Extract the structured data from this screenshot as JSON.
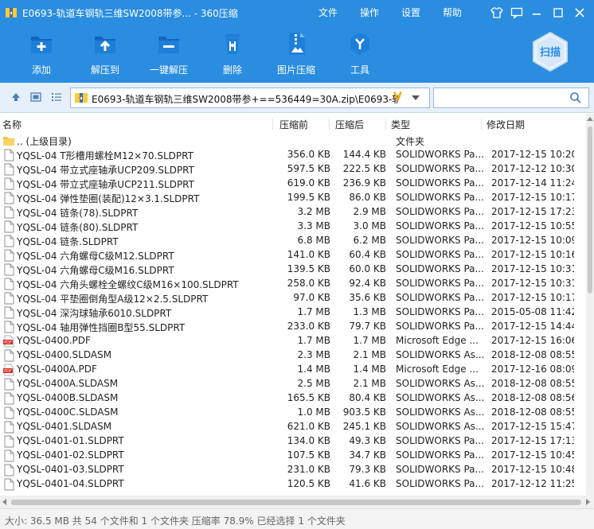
{
  "window": {
    "title": "E0693-轨道车钢轨三维SW2008带参... - 360压缩",
    "menus": [
      "文件",
      "操作",
      "设置",
      "帮助"
    ]
  },
  "toolbar": {
    "items": [
      "添加",
      "解压到",
      "一键解压",
      "删除",
      "图片压缩",
      "工具"
    ],
    "scan_label": "扫描"
  },
  "address": {
    "path": "E0693-轨道车钢轨三维SW2008带参+==536449=30A.zip\\E0693-轨道"
  },
  "search": {
    "placeholder": ""
  },
  "columns": {
    "name": "名称",
    "size": "压缩前",
    "packed": "压缩后",
    "type": "类型",
    "date": "修改日期"
  },
  "files": [
    {
      "icon": "folder",
      "name": ".. (上级目录)",
      "size": "",
      "packed": "",
      "type": "文件夹",
      "date": ""
    },
    {
      "icon": "file",
      "name": "YQSL-04 T形槽用螺栓M12×70.SLDPRT",
      "size": "356.0 KB",
      "packed": "144.4 KB",
      "type": "SOLIDWORKS Pa...",
      "date": "2017-12-15 10:20"
    },
    {
      "icon": "file",
      "name": "YQSL-04 带立式座轴承UCP209.SLDPRT",
      "size": "597.5 KB",
      "packed": "222.5 KB",
      "type": "SOLIDWORKS Pa...",
      "date": "2017-12-12 10:30"
    },
    {
      "icon": "file",
      "name": "YQSL-04 带立式座轴承UCP211.SLDPRT",
      "size": "619.0 KB",
      "packed": "236.9 KB",
      "type": "SOLIDWORKS Pa...",
      "date": "2017-12-14 11:24"
    },
    {
      "icon": "file",
      "name": "YQSL-04 弹性垫圈(装配)12×3.1.SLDPRT",
      "size": "199.5 KB",
      "packed": "86.0 KB",
      "type": "SOLIDWORKS Pa...",
      "date": "2017-12-15 10:17"
    },
    {
      "icon": "file",
      "name": "YQSL-04 链条(78).SLDPRT",
      "size": "3.2 MB",
      "packed": "2.9 MB",
      "type": "SOLIDWORKS Pa...",
      "date": "2017-12-15 17:23"
    },
    {
      "icon": "file",
      "name": "YQSL-04 链条(80).SLDPRT",
      "size": "3.3 MB",
      "packed": "3.0 MB",
      "type": "SOLIDWORKS Pa...",
      "date": "2017-12-15 10:55"
    },
    {
      "icon": "file",
      "name": "YQSL-04 链条.SLDPRT",
      "size": "6.8 MB",
      "packed": "6.2 MB",
      "type": "SOLIDWORKS Pa...",
      "date": "2017-12-15 10:09"
    },
    {
      "icon": "file",
      "name": "YQSL-04 六角螺母C级M12.SLDPRT",
      "size": "141.0 KB",
      "packed": "60.4 KB",
      "type": "SOLIDWORKS Pa...",
      "date": "2017-12-15 10:16"
    },
    {
      "icon": "file",
      "name": "YQSL-04 六角螺母C级M16.SLDPRT",
      "size": "139.5 KB",
      "packed": "60.0 KB",
      "type": "SOLIDWORKS Pa...",
      "date": "2017-12-15 10:31"
    },
    {
      "icon": "file",
      "name": "YQSL-04 六角头螺栓全螺纹C级M16×100.SLDPRT",
      "size": "258.0 KB",
      "packed": "92.4 KB",
      "type": "SOLIDWORKS Pa...",
      "date": "2017-12-15 10:31"
    },
    {
      "icon": "file",
      "name": "YQSL-04 平垫圈倒角型A级12×2.5.SLDPRT",
      "size": "97.0 KB",
      "packed": "35.6 KB",
      "type": "SOLIDWORKS Pa...",
      "date": "2017-12-15 10:17"
    },
    {
      "icon": "file",
      "name": "YQSL-04 深沟球轴承6010.SLDPRT",
      "size": "1.7 MB",
      "packed": "1.3 MB",
      "type": "SOLIDWORKS Pa...",
      "date": "2015-05-08 11:42"
    },
    {
      "icon": "file",
      "name": "YQSL-04 轴用弹性挡圈B型55.SLDPRT",
      "size": "233.0 KB",
      "packed": "79.7 KB",
      "type": "SOLIDWORKS Pa...",
      "date": "2017-12-15 14:44"
    },
    {
      "icon": "pdf",
      "name": "YQSL-0400.PDF",
      "size": "1.7 MB",
      "packed": "1.7 MB",
      "type": "Microsoft Edge ...",
      "date": "2017-12-15 16:06"
    },
    {
      "icon": "file",
      "name": "YQSL-0400.SLDASM",
      "size": "2.3 MB",
      "packed": "2.1 MB",
      "type": "SOLIDWORKS As...",
      "date": "2018-12-08 08:55"
    },
    {
      "icon": "pdf",
      "name": "YQSL-0400A.PDF",
      "size": "1.4 MB",
      "packed": "1.4 MB",
      "type": "Microsoft Edge ...",
      "date": "2017-12-16 08:09"
    },
    {
      "icon": "file",
      "name": "YQSL-0400A.SLDASM",
      "size": "2.5 MB",
      "packed": "2.1 MB",
      "type": "SOLIDWORKS As...",
      "date": "2018-12-08 08:55"
    },
    {
      "icon": "file",
      "name": "YQSL-0400B.SLDASM",
      "size": "165.5 KB",
      "packed": "80.4 KB",
      "type": "SOLIDWORKS As...",
      "date": "2018-12-08 08:56"
    },
    {
      "icon": "file",
      "name": "YQSL-0400C.SLDASM",
      "size": "1.0 MB",
      "packed": "903.5 KB",
      "type": "SOLIDWORKS As...",
      "date": "2018-12-08 08:55"
    },
    {
      "icon": "file",
      "name": "YQSL-0401.SLDASM",
      "size": "621.0 KB",
      "packed": "245.1 KB",
      "type": "SOLIDWORKS As...",
      "date": "2017-12-15 15:47"
    },
    {
      "icon": "file",
      "name": "YQSL-0401-01.SLDPRT",
      "size": "134.0 KB",
      "packed": "49.3 KB",
      "type": "SOLIDWORKS Pa...",
      "date": "2017-12-15 17:13"
    },
    {
      "icon": "file",
      "name": "YQSL-0401-02.SLDPRT",
      "size": "107.5 KB",
      "packed": "34.7 KB",
      "type": "SOLIDWORKS Pa...",
      "date": "2017-12-15 10:45"
    },
    {
      "icon": "file",
      "name": "YQSL-0401-03.SLDPRT",
      "size": "231.0 KB",
      "packed": "79.3 KB",
      "type": "SOLIDWORKS Pa...",
      "date": "2017-12-15 10:48"
    },
    {
      "icon": "file",
      "name": "YQSL-0401-04.SLDPRT",
      "size": "120.5 KB",
      "packed": "41.6 KB",
      "type": "SOLIDWORKS Pa...",
      "date": "2017-12-12 11:25"
    }
  ],
  "status": {
    "text": "大小: 36.5 MB 共 54 个文件和 1 个文件夹 压缩率 78.9% 已经选择 1 个文件夹"
  },
  "colors": {
    "header_blue": "#2a8de0",
    "addr_bg": "#e6f0fa"
  }
}
